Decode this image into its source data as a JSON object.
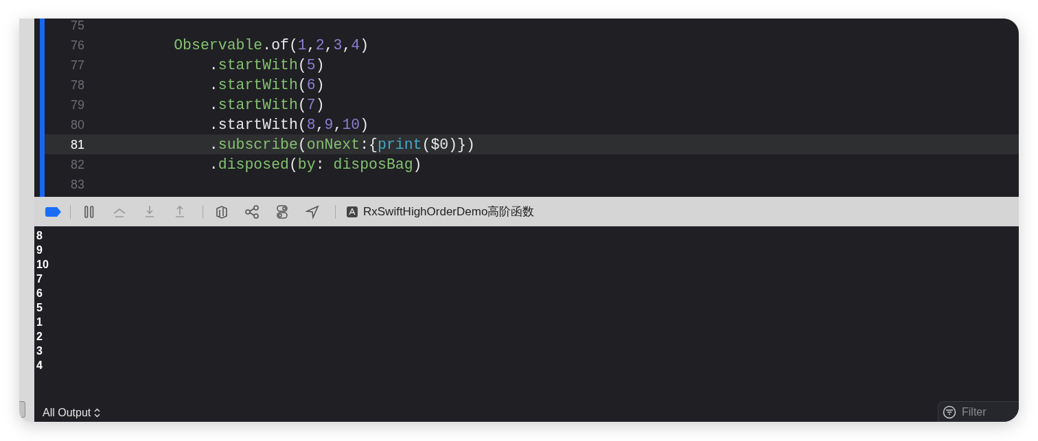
{
  "editor": {
    "lines": [
      {
        "number": "75",
        "current": false
      },
      {
        "number": "76",
        "current": false,
        "tokens": [
          {
            "text": "        Observable",
            "kind": "type"
          },
          {
            "text": ".of(",
            "kind": "plain"
          },
          {
            "text": "1",
            "kind": "number"
          },
          {
            "text": ",",
            "kind": "plain"
          },
          {
            "text": "2",
            "kind": "number"
          },
          {
            "text": ",",
            "kind": "plain"
          },
          {
            "text": "3",
            "kind": "number"
          },
          {
            "text": ",",
            "kind": "plain"
          },
          {
            "text": "4",
            "kind": "number"
          },
          {
            "text": ")",
            "kind": "plain"
          }
        ]
      },
      {
        "number": "77",
        "current": false,
        "tokens": [
          {
            "text": "            .",
            "kind": "plain"
          },
          {
            "text": "startWith",
            "kind": "type"
          },
          {
            "text": "(",
            "kind": "plain"
          },
          {
            "text": "5",
            "kind": "number"
          },
          {
            "text": ")",
            "kind": "plain"
          }
        ]
      },
      {
        "number": "78",
        "current": false,
        "tokens": [
          {
            "text": "            .",
            "kind": "plain"
          },
          {
            "text": "startWith",
            "kind": "type"
          },
          {
            "text": "(",
            "kind": "plain"
          },
          {
            "text": "6",
            "kind": "number"
          },
          {
            "text": ")",
            "kind": "plain"
          }
        ]
      },
      {
        "number": "79",
        "current": false,
        "tokens": [
          {
            "text": "            .",
            "kind": "plain"
          },
          {
            "text": "startWith",
            "kind": "type"
          },
          {
            "text": "(",
            "kind": "plain"
          },
          {
            "text": "7",
            "kind": "number"
          },
          {
            "text": ")",
            "kind": "plain"
          }
        ]
      },
      {
        "number": "80",
        "current": false,
        "tokens": [
          {
            "text": "            .startWith(",
            "kind": "plain"
          },
          {
            "text": "8",
            "kind": "number"
          },
          {
            "text": ",",
            "kind": "plain"
          },
          {
            "text": "9",
            "kind": "number"
          },
          {
            "text": ",",
            "kind": "plain"
          },
          {
            "text": "10",
            "kind": "number"
          },
          {
            "text": ")",
            "kind": "plain"
          }
        ]
      },
      {
        "number": "81",
        "current": true,
        "tokens": [
          {
            "text": "            .",
            "kind": "plain"
          },
          {
            "text": "subscribe",
            "kind": "type"
          },
          {
            "text": "(",
            "kind": "plain"
          },
          {
            "text": "onNext",
            "kind": "type"
          },
          {
            "text": ":{",
            "kind": "plain"
          },
          {
            "text": "print",
            "kind": "func"
          },
          {
            "text": "($0)})",
            "kind": "plain"
          }
        ]
      },
      {
        "number": "82",
        "current": false,
        "tokens": [
          {
            "text": "            .",
            "kind": "plain"
          },
          {
            "text": "disposed",
            "kind": "type"
          },
          {
            "text": "(",
            "kind": "plain"
          },
          {
            "text": "by",
            "kind": "type"
          },
          {
            "text": ": ",
            "kind": "plain"
          },
          {
            "text": "disposBag",
            "kind": "type"
          },
          {
            "text": ")",
            "kind": "plain"
          }
        ]
      },
      {
        "number": "83",
        "current": false
      }
    ]
  },
  "debug_bar": {
    "scheme": "RxSwiftHighOrderDemo高阶函数"
  },
  "console": {
    "output": [
      "8",
      "9",
      "10",
      "7",
      "6",
      "5",
      "1",
      "2",
      "3",
      "4"
    ],
    "scope": "All Output",
    "filter": {
      "placeholder": "Filter"
    }
  }
}
